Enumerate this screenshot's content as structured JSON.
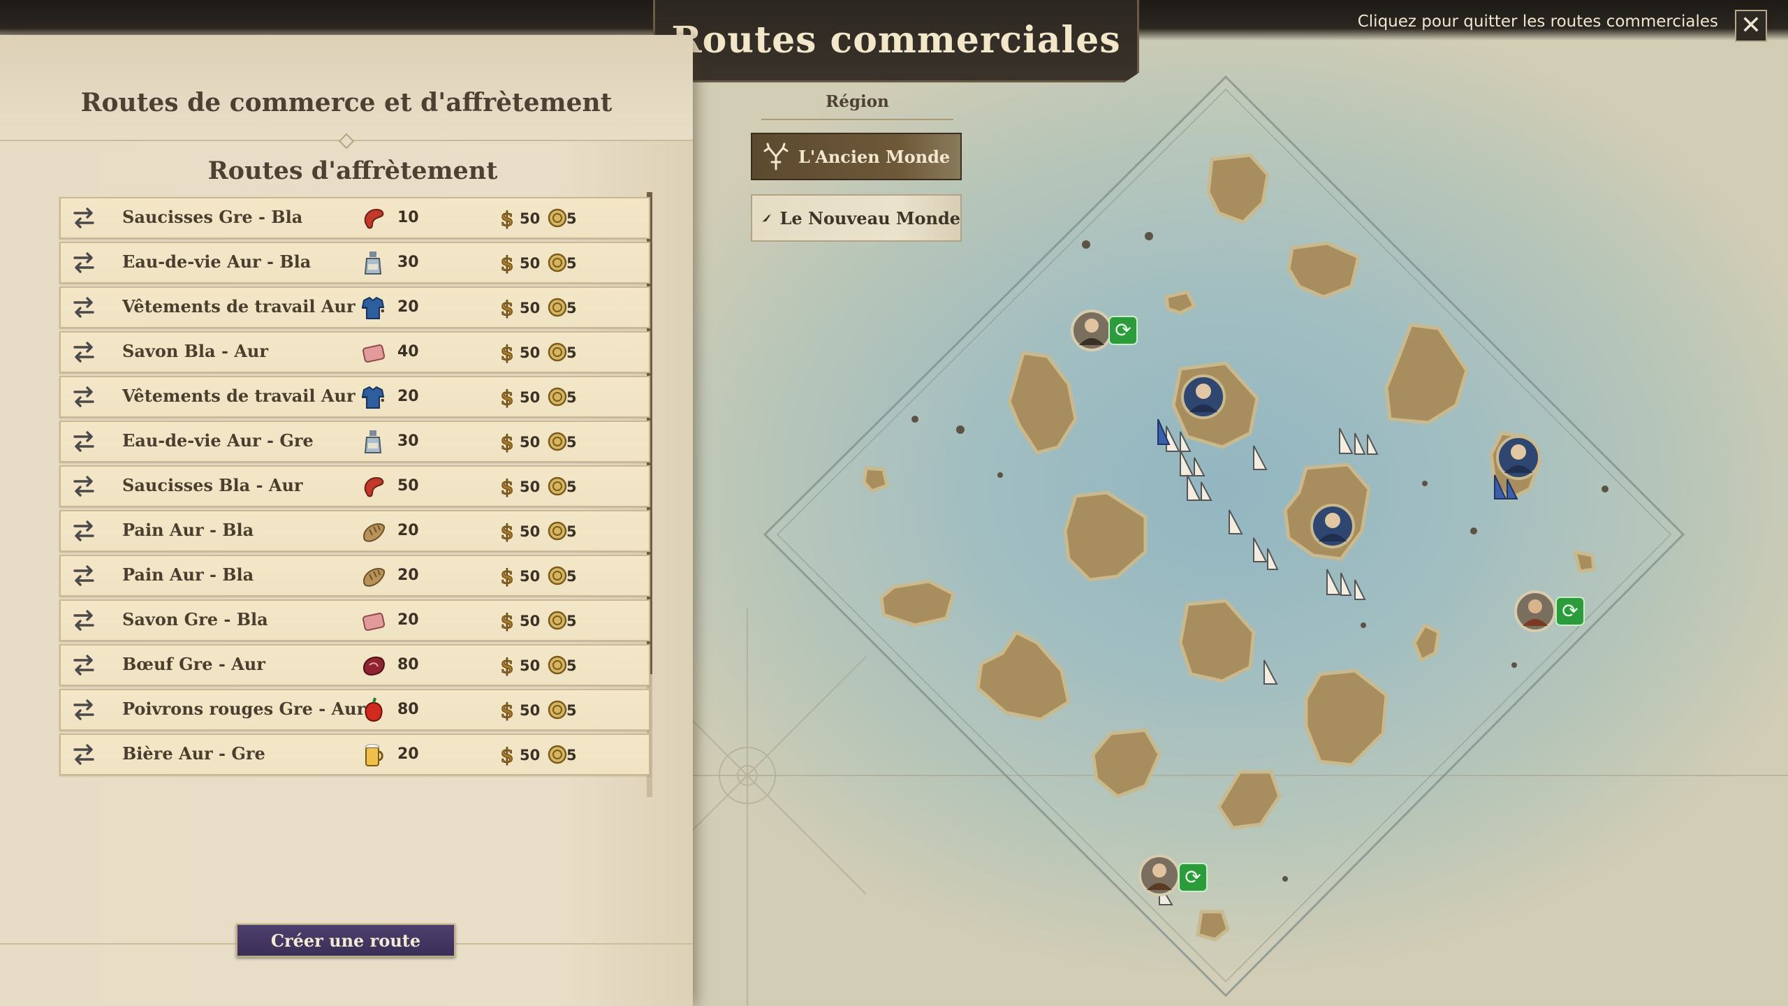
{
  "header": {
    "title": "Routes commerciales",
    "exit_hint": "Cliquez pour quitter les routes commerciales",
    "close_symbol": "✕"
  },
  "panel": {
    "title": "Routes de commerce et d'affrètement",
    "list_title": "Routes d'affrètement",
    "create_button": "Créer une route"
  },
  "routes": [
    {
      "name": "Saucisses Gre - Bla",
      "good_icon": "sausage-icon",
      "qty": "10",
      "cost": "50",
      "influence": "5"
    },
    {
      "name": "Eau-de-vie Aur - Bla",
      "good_icon": "schnapps-icon",
      "qty": "30",
      "cost": "50",
      "influence": "5"
    },
    {
      "name": "Vêtements de travail Aur -...",
      "good_icon": "work-clothes-icon",
      "qty": "20",
      "cost": "50",
      "influence": "5"
    },
    {
      "name": "Savon Bla - Aur",
      "good_icon": "soap-icon",
      "qty": "40",
      "cost": "50",
      "influence": "5"
    },
    {
      "name": "Vêtements de travail Aur -...",
      "good_icon": "work-clothes-icon",
      "qty": "20",
      "cost": "50",
      "influence": "5"
    },
    {
      "name": "Eau-de-vie Aur - Gre",
      "good_icon": "schnapps-icon",
      "qty": "30",
      "cost": "50",
      "influence": "5"
    },
    {
      "name": "Saucisses Bla - Aur",
      "good_icon": "sausage-icon",
      "qty": "50",
      "cost": "50",
      "influence": "5"
    },
    {
      "name": "Pain Aur - Bla",
      "good_icon": "bread-icon",
      "qty": "20",
      "cost": "50",
      "influence": "5"
    },
    {
      "name": "Pain Aur - Bla",
      "good_icon": "bread-icon",
      "qty": "20",
      "cost": "50",
      "influence": "5"
    },
    {
      "name": "Savon Gre - Bla",
      "good_icon": "soap-icon",
      "qty": "20",
      "cost": "50",
      "influence": "5"
    },
    {
      "name": "Bœuf Gre - Aur",
      "good_icon": "beef-icon",
      "qty": "80",
      "cost": "50",
      "influence": "5"
    },
    {
      "name": "Poivrons rouges Gre - Aur",
      "good_icon": "red-pepper-icon",
      "qty": "80",
      "cost": "50",
      "influence": "5"
    },
    {
      "name": "Bière Aur - Gre",
      "good_icon": "beer-icon",
      "qty": "20",
      "cost": "50",
      "influence": "5"
    }
  ],
  "region": {
    "label": "Région",
    "options": [
      {
        "label": "L'Ancien Monde",
        "icon": "stag-icon",
        "selected": true
      },
      {
        "label": "Le Nouveau Monde",
        "icon": "bird-icon",
        "selected": false
      }
    ]
  },
  "colors": {
    "accent_button": "#3f3360",
    "selected_region": "#5c4a30",
    "sea": "#8fb4bf",
    "land": "#a88e5f"
  }
}
